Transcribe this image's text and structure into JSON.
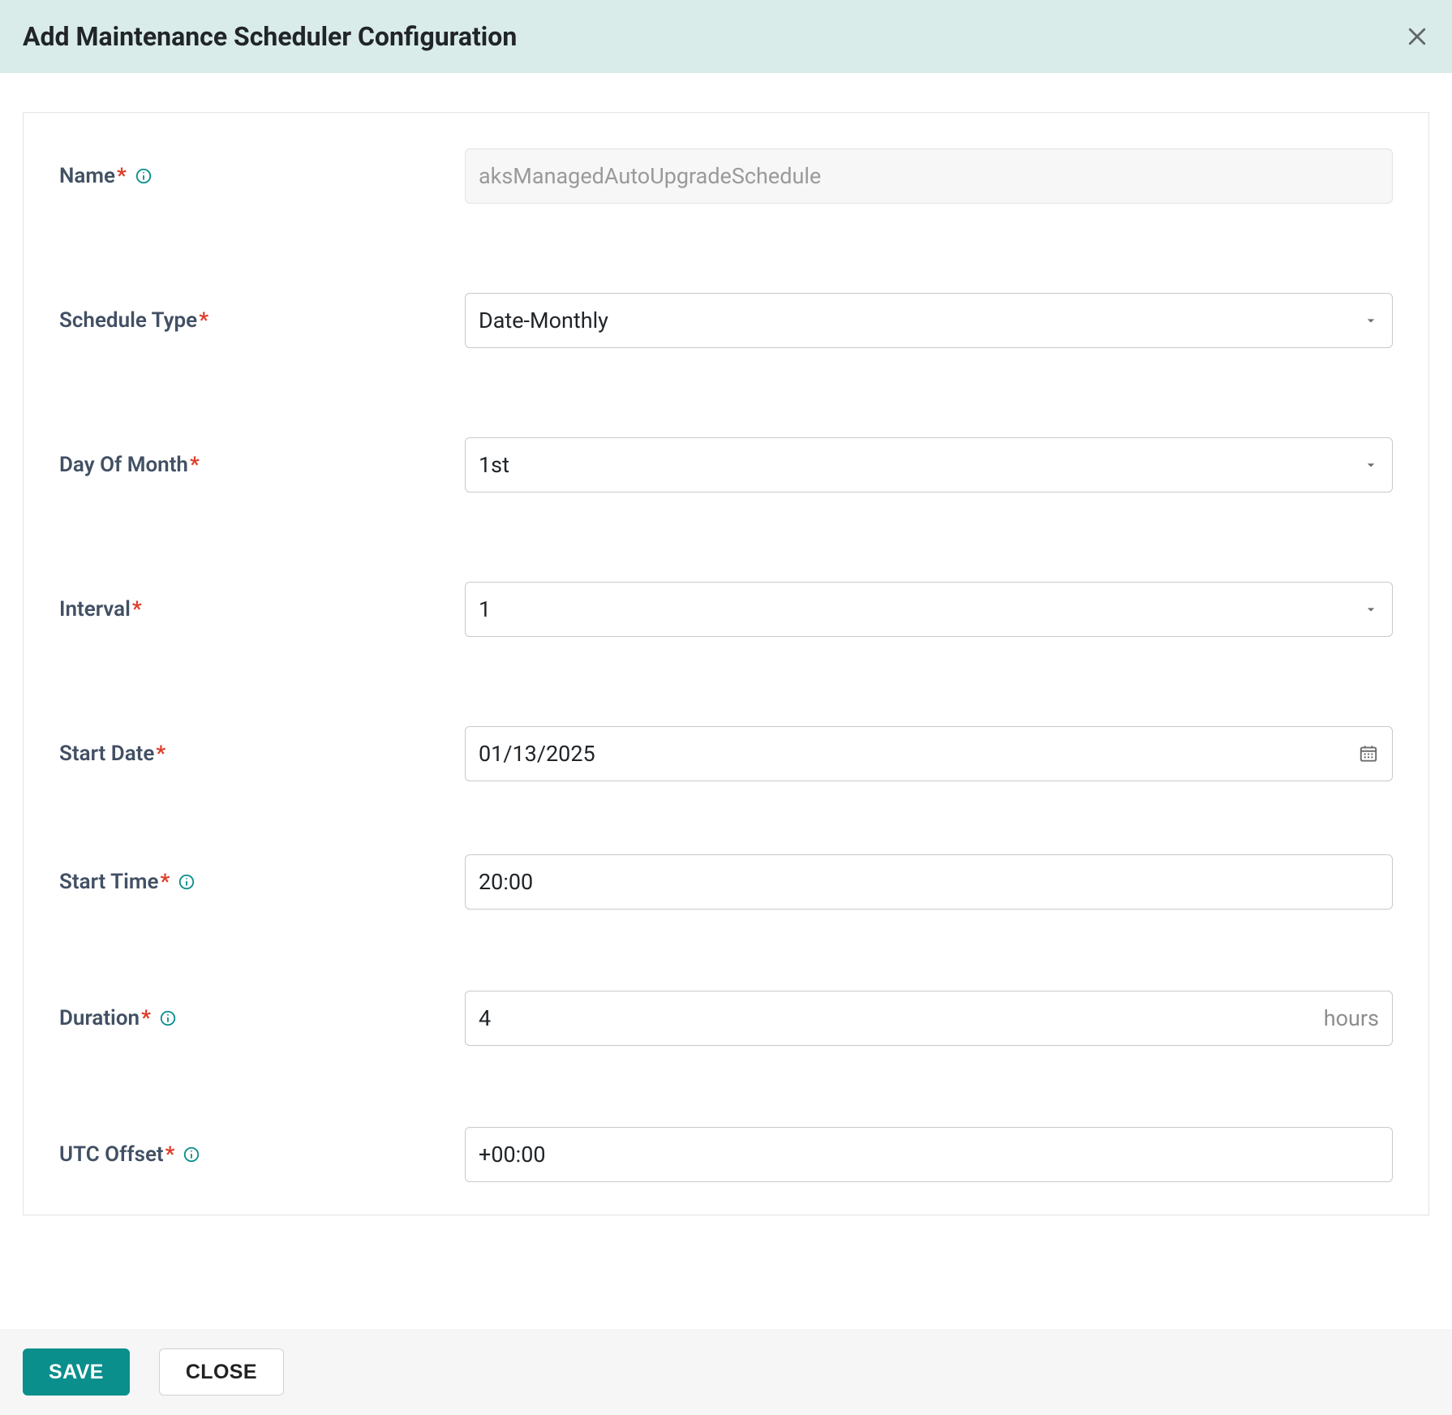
{
  "header": {
    "title": "Add Maintenance Scheduler Configuration"
  },
  "form": {
    "name": {
      "label": "Name",
      "placeholder": "aksManagedAutoUpgradeSchedule"
    },
    "scheduleType": {
      "label": "Schedule Type",
      "value": "Date-Monthly"
    },
    "dayOfMonth": {
      "label": "Day Of Month",
      "value": "1st"
    },
    "interval": {
      "label": "Interval",
      "value": "1"
    },
    "startDate": {
      "label": "Start Date",
      "value": "01/13/2025"
    },
    "startTime": {
      "label": "Start Time",
      "value": "20:00"
    },
    "duration": {
      "label": "Duration",
      "value": "4",
      "suffix": "hours"
    },
    "utcOffset": {
      "label": "UTC Offset",
      "value": "+00:00"
    }
  },
  "footer": {
    "save": "SAVE",
    "close": "CLOSE"
  }
}
